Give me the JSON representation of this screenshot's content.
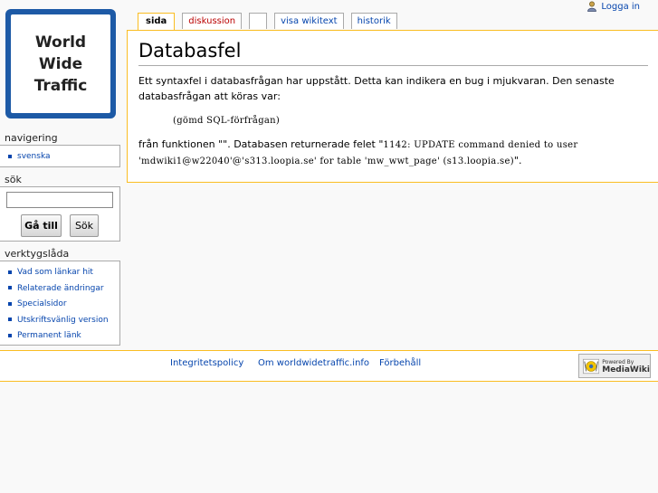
{
  "personal": {
    "login_label": "Logga in",
    "icon": "user-icon"
  },
  "logo": {
    "lines": [
      "World",
      "Wide",
      "Traffic"
    ],
    "color": "#1d5aa6"
  },
  "tabs": [
    {
      "label": "sida",
      "selected": true
    },
    {
      "label": "diskussion",
      "new": true
    },
    {
      "label": ""
    },
    {
      "label": "visa wikitext"
    },
    {
      "label": "historik"
    }
  ],
  "page": {
    "title": "Databasfel",
    "intro": "Ett syntaxfel i databasfrågan har uppstått. Detta kan indikera en bug i mjukvaran. Den senaste databasfrågan att köras var:",
    "query": "(gömd SQL-förfrågan)",
    "func_prefix": "från funktionen \"\". Databasen returnerade felet \"",
    "error": "1142: UPDATE command denied to user 'mdwiki1@w22040'@'s313.loopia.se' for table 'mw_wwt_page' (s13.loopia.se)",
    "func_suffix": "\"."
  },
  "sidebar": {
    "nav": {
      "heading": "navigering",
      "items": [
        {
          "label": "svenska"
        }
      ]
    },
    "search": {
      "heading": "sök",
      "go_label": "Gå till",
      "search_label": "Sök",
      "value": ""
    },
    "toolbox": {
      "heading": "verktygslåda",
      "items": [
        {
          "label": "Vad som länkar hit"
        },
        {
          "label": "Relaterade ändringar"
        },
        {
          "label": "Specialsidor"
        },
        {
          "label": "Utskriftsvänlig version"
        },
        {
          "label": "Permanent länk"
        }
      ]
    }
  },
  "footer": {
    "links": [
      {
        "label": "Integritetspolicy"
      },
      {
        "label": "Om worldwidetraffic.info"
      },
      {
        "label": "Förbehåll"
      }
    ],
    "powered_small": "Powered By",
    "powered_big": "MediaWiki"
  },
  "colors": {
    "accent_border": "#fabd23",
    "link": "#0645ad",
    "new_link": "#ba0000"
  }
}
